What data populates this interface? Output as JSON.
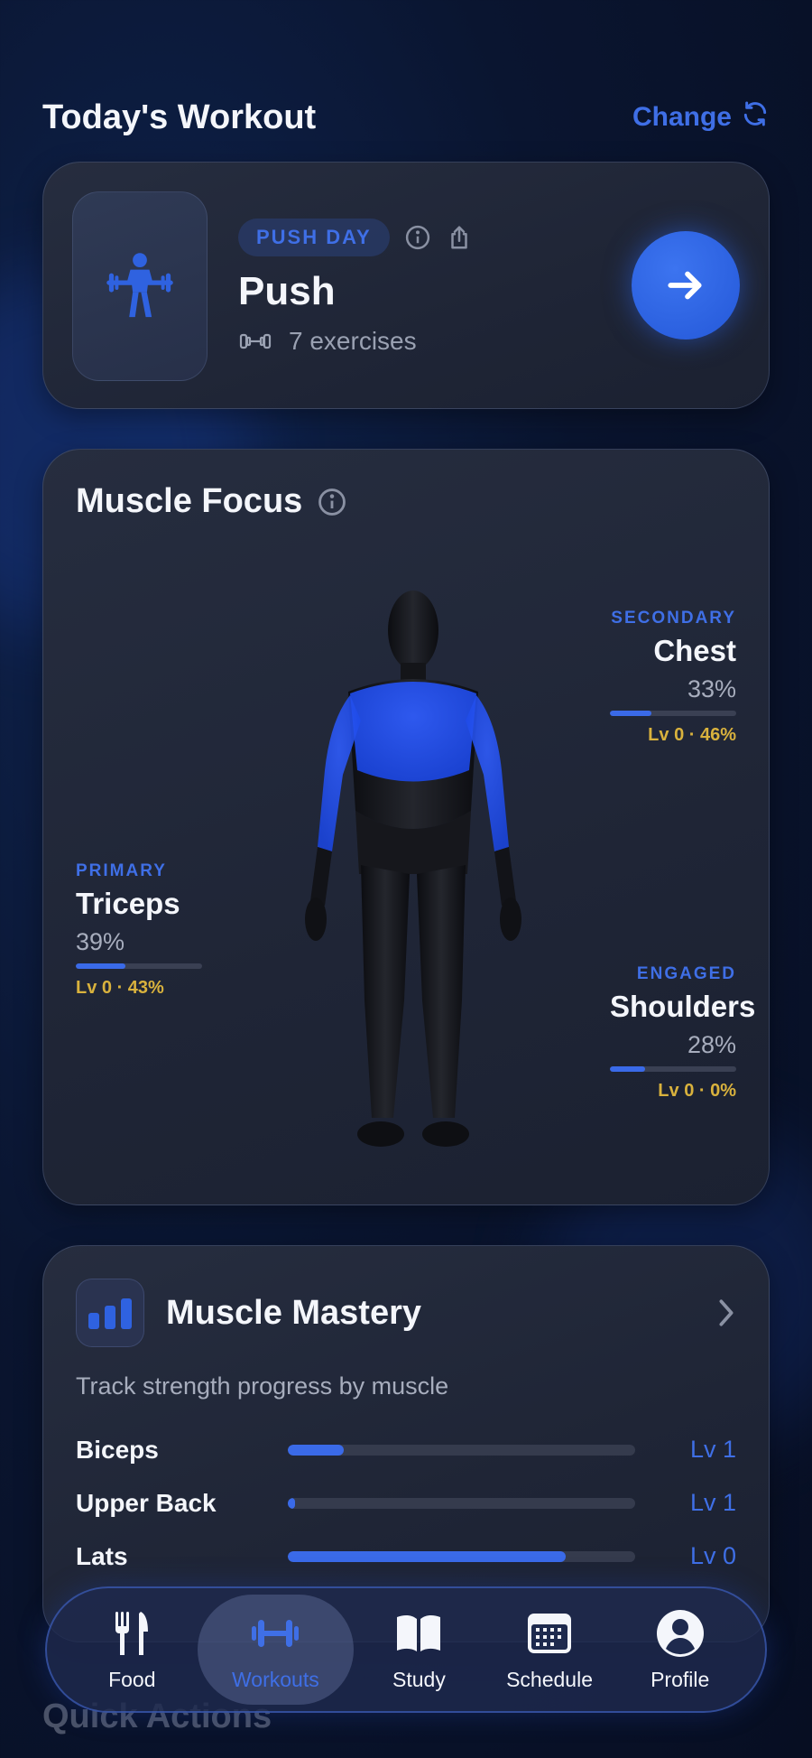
{
  "header": {
    "title": "Today's Workout",
    "change_label": "Change"
  },
  "workout": {
    "tag": "PUSH DAY",
    "name": "Push",
    "exercise_count": "7 exercises"
  },
  "muscle_focus": {
    "title": "Muscle Focus",
    "stats": [
      {
        "kind": "SECONDARY",
        "name": "Chest",
        "percent": "33%",
        "fill": 0.33,
        "level": "Lv 0 · 46%"
      },
      {
        "kind": "PRIMARY",
        "name": "Triceps",
        "percent": "39%",
        "fill": 0.39,
        "level": "Lv 0 · 43%"
      },
      {
        "kind": "ENGAGED",
        "name": "Shoulders",
        "percent": "28%",
        "fill": 0.28,
        "level": "Lv 0 · 0%"
      }
    ]
  },
  "mastery": {
    "title": "Muscle Mastery",
    "subtitle": "Track strength progress by muscle",
    "items": [
      {
        "name": "Biceps",
        "level": "Lv 1",
        "progress": 0.16
      },
      {
        "name": "Upper Back",
        "level": "Lv 1",
        "progress": 0.02
      },
      {
        "name": "Lats",
        "level": "Lv 0",
        "progress": 0.8
      }
    ]
  },
  "quick_actions": {
    "title": "Quick Actions"
  },
  "nav": {
    "items": [
      {
        "label": "Food",
        "icon": "fork-knife-icon"
      },
      {
        "label": "Workouts",
        "icon": "dumbbell-icon",
        "active": true
      },
      {
        "label": "Study",
        "icon": "book-icon"
      },
      {
        "label": "Schedule",
        "icon": "calendar-icon"
      },
      {
        "label": "Profile",
        "icon": "person-icon"
      }
    ]
  },
  "colors": {
    "accent": "#3f6fe6",
    "level_gold": "#d9b23d",
    "card": "#232a3b",
    "background": "#0a1530"
  }
}
